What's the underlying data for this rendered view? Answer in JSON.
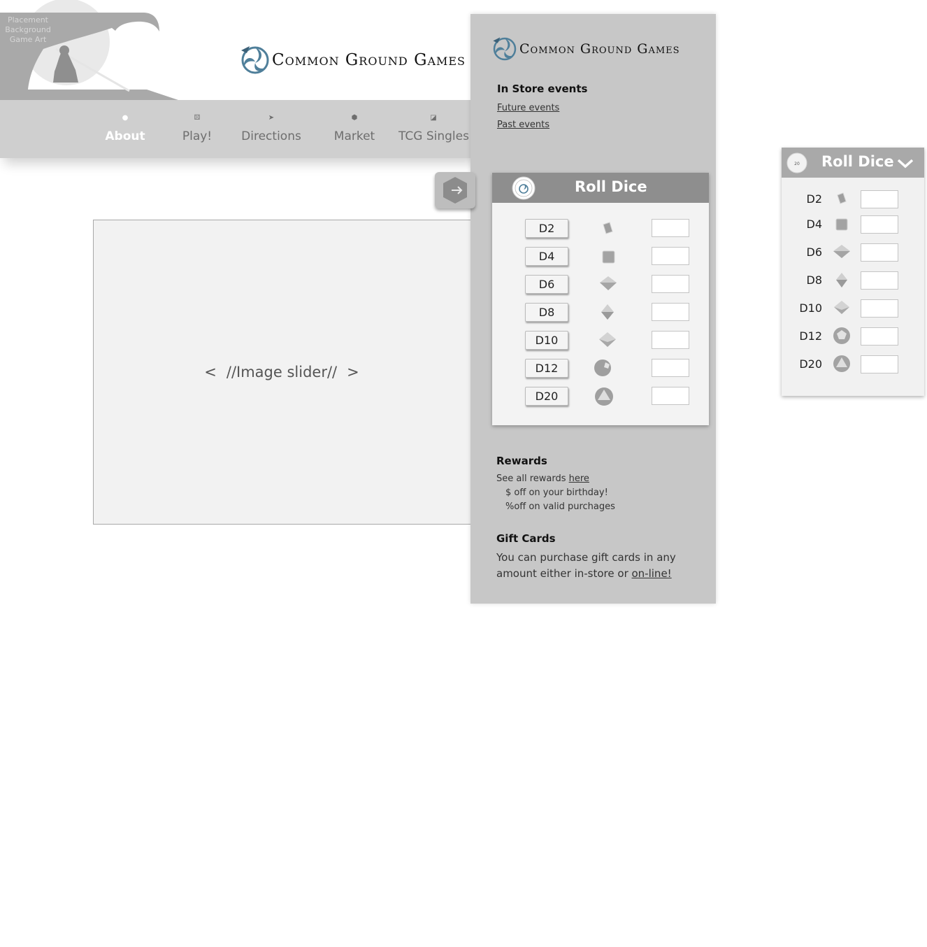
{
  "header": {
    "background_art_note": "Placement Background Game Art",
    "brand_name": "Common Ground Games"
  },
  "nav": {
    "items": [
      {
        "label": "About",
        "icon": "soccer-ball-icon",
        "active": true
      },
      {
        "label": "Play!",
        "icon": "dice-icon",
        "active": false
      },
      {
        "label": "Directions",
        "icon": "location-arrow-icon",
        "active": false
      },
      {
        "label": "Market",
        "icon": "cube-icon",
        "active": false
      },
      {
        "label": "TCG Singles",
        "icon": "card-icon",
        "active": false
      }
    ]
  },
  "slider": {
    "prev": "<",
    "text": "//Image slider//",
    "next": ">"
  },
  "panel": {
    "brand_name": "Common Ground Games",
    "in_store": {
      "title": "In Store events",
      "future_link": "Future events",
      "past_link": "Past events"
    },
    "dice": {
      "title": "Roll Dice",
      "dice": [
        "D2",
        "D4",
        "D6",
        "D8",
        "D10",
        "D12",
        "D20"
      ],
      "results": [
        "",
        "",
        "",
        "",
        "",
        "",
        ""
      ]
    },
    "rewards": {
      "title": "Rewards",
      "intro": "See all rewards ",
      "link": "here",
      "line1": "$ off on your birthday!",
      "line2": "%off on valid purchages"
    },
    "gift_cards": {
      "title": "Gift Cards",
      "text": "You can purchase gift cards in any amount either in-store or ",
      "link": "on-line!"
    }
  },
  "widget": {
    "title": "Roll Dice",
    "seal_text": "20",
    "dice": [
      "D2",
      "D4",
      "D6",
      "D8",
      "D10",
      "D12",
      "D20"
    ],
    "results": [
      "",
      "",
      "",
      "",
      "",
      "",
      ""
    ]
  },
  "colors": {
    "panel_bg": "#c7c7c7",
    "nav_bg": "#cfcfcf",
    "card_header": "#8e8e8e",
    "widget_header": "#a9a9a9",
    "logo_blue": "#4f7f9a"
  }
}
